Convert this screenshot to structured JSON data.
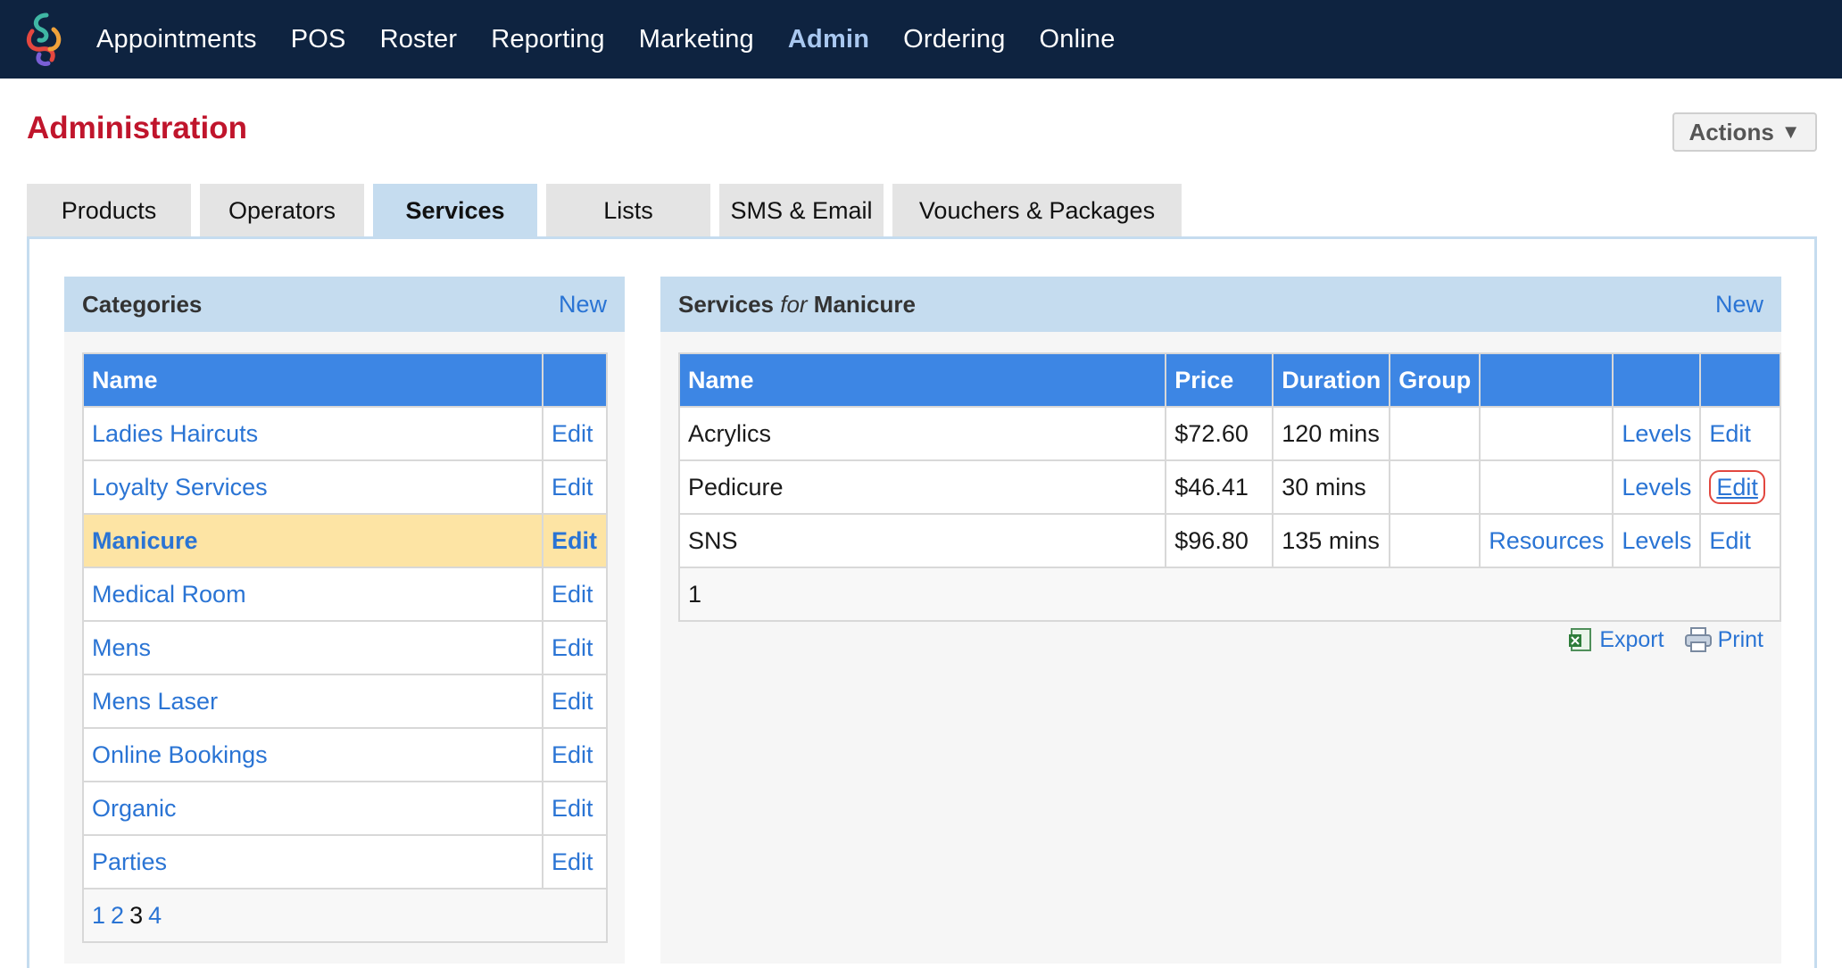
{
  "nav": {
    "items": [
      {
        "label": "Appointments",
        "active": false
      },
      {
        "label": "POS",
        "active": false
      },
      {
        "label": "Roster",
        "active": false
      },
      {
        "label": "Reporting",
        "active": false
      },
      {
        "label": "Marketing",
        "active": false
      },
      {
        "label": "Admin",
        "active": true
      },
      {
        "label": "Ordering",
        "active": false
      },
      {
        "label": "Online",
        "active": false
      }
    ]
  },
  "page": {
    "title": "Administration",
    "actions_label": "Actions",
    "actions_caret": "▼"
  },
  "tabs": [
    {
      "label": "Products"
    },
    {
      "label": "Operators"
    },
    {
      "label": "Services",
      "active": true
    },
    {
      "label": "Lists"
    },
    {
      "label": "SMS & Email"
    },
    {
      "label": "Vouchers & Packages"
    }
  ],
  "categories": {
    "title": "Categories",
    "new_label": "New",
    "header_name": "Name",
    "edit_label": "Edit",
    "rows": [
      {
        "name": "Ladies Haircuts"
      },
      {
        "name": "Loyalty Services"
      },
      {
        "name": "Manicure",
        "selected": true
      },
      {
        "name": "Medical Room"
      },
      {
        "name": "Mens"
      },
      {
        "name": "Mens Laser"
      },
      {
        "name": "Online Bookings"
      },
      {
        "name": "Organic"
      },
      {
        "name": "Parties"
      }
    ],
    "pages": [
      "1",
      "2",
      "3",
      "4"
    ],
    "current_page": "3"
  },
  "services": {
    "title_prefix": "Services",
    "title_for": "for",
    "title_category": "Manicure",
    "new_label": "New",
    "headers": {
      "name": "Name",
      "price": "Price",
      "duration": "Duration",
      "group": "Group"
    },
    "rows": [
      {
        "name": "Acrylics",
        "price": "$72.60",
        "duration": "120 mins",
        "group": "",
        "resources": "",
        "levels": "Levels",
        "edit": "Edit"
      },
      {
        "name": "Pedicure",
        "price": "$46.41",
        "duration": "30 mins",
        "group": "",
        "resources": "",
        "levels": "Levels",
        "edit": "Edit"
      },
      {
        "name": "SNS",
        "price": "$96.80",
        "duration": "135 mins",
        "group": "",
        "resources": "Resources",
        "levels": "Levels",
        "edit": "Edit"
      }
    ],
    "pager": "1",
    "export_label": "Export",
    "print_label": "Print"
  },
  "colors": {
    "nav_bg": "#0e2340",
    "title": "#c0152c",
    "link": "#2a74d4",
    "header": "#3d86e4",
    "panel_header": "#c5dcef",
    "selected": "#fde4a4"
  }
}
